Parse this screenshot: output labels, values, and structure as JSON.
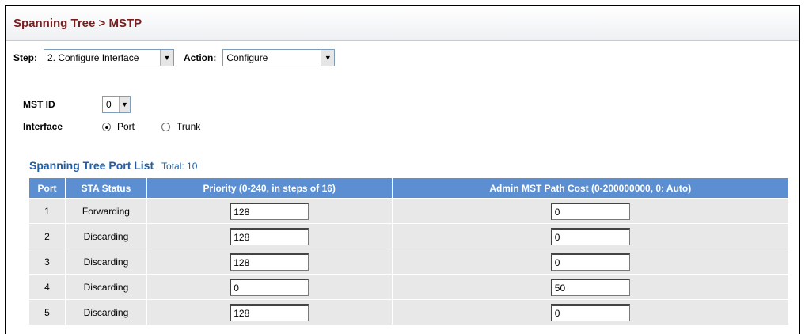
{
  "page": {
    "title": "Spanning Tree > MSTP"
  },
  "toolbar": {
    "step_label": "Step:",
    "step_value": "2. Configure Interface",
    "action_label": "Action:",
    "action_value": "Configure"
  },
  "form": {
    "mst_id_label": "MST ID",
    "mst_id_value": "0",
    "interface_label": "Interface",
    "interface_options": [
      {
        "label": "Port",
        "selected": true
      },
      {
        "label": "Trunk",
        "selected": false
      }
    ]
  },
  "port_list": {
    "title": "Spanning Tree Port List",
    "total": "Total: 10",
    "columns": [
      "Port",
      "STA Status",
      "Priority (0-240, in steps of 16)",
      "Admin MST Path Cost (0-200000000, 0: Auto)"
    ],
    "rows": [
      {
        "port": "1",
        "status": "Forwarding",
        "priority": "128",
        "cost": "0"
      },
      {
        "port": "2",
        "status": "Discarding",
        "priority": "128",
        "cost": "0"
      },
      {
        "port": "3",
        "status": "Discarding",
        "priority": "128",
        "cost": "0"
      },
      {
        "port": "4",
        "status": "Discarding",
        "priority": "0",
        "cost": "50"
      },
      {
        "port": "5",
        "status": "Discarding",
        "priority": "128",
        "cost": "0"
      }
    ]
  },
  "colors": {
    "title": "#7a1d1d",
    "table_header": "#5b8fd2",
    "caption": "#1f5fa8",
    "row_bg": "#e8e8e8"
  },
  "icons": {
    "dropdown": "chevron-down-icon",
    "radio": "radio-icon"
  }
}
